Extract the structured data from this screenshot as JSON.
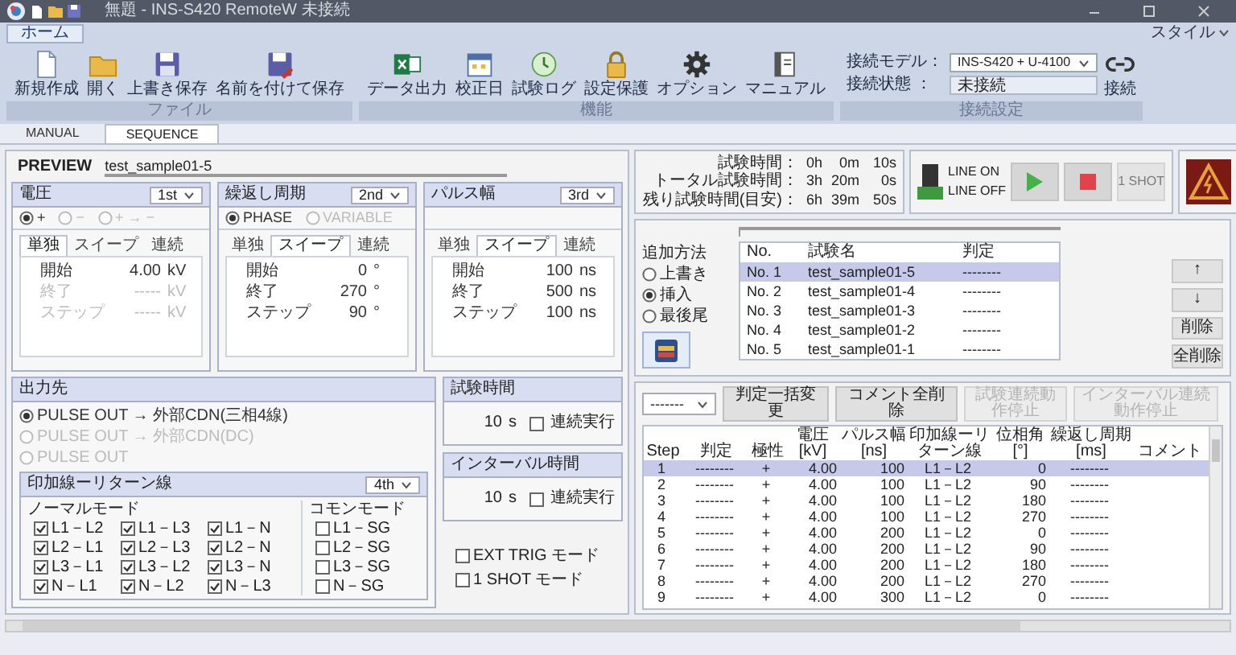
{
  "window": {
    "title": "無題 - INS-S420 RemoteW 未接続",
    "style_menu": "スタイル"
  },
  "ribbon": {
    "tabs": [
      {
        "label": "ホーム",
        "selected": true
      }
    ],
    "groups": [
      {
        "label": "ファイル",
        "buttons": [
          "新規作成",
          "開く",
          "上書き保存",
          "名前を付けて保存"
        ]
      },
      {
        "label": "機能",
        "buttons": [
          "データ出力",
          "校正日",
          "試験ログ",
          "設定保護",
          "オプション",
          "マニュアル"
        ]
      }
    ],
    "connection": {
      "label": "接続設定",
      "model_label": "接続モデル：",
      "model": "INS-S420 + U-4100",
      "status_label": "接続状態 ：",
      "status": "未接続",
      "connect_button": "接続"
    }
  },
  "mode_tabs": [
    {
      "label": "MANUAL",
      "selected": false
    },
    {
      "label": "SEQUENCE",
      "selected": true
    }
  ],
  "preview": {
    "label": "PREVIEW",
    "value": "test_sample01-5"
  },
  "panels": [
    {
      "title": "電圧",
      "order": "1st",
      "options": [
        {
          "label": "+",
          "selected": true,
          "disabled": false
        },
        {
          "label": "−",
          "selected": false,
          "disabled": true
        },
        {
          "label": "+ → −",
          "selected": false,
          "disabled": true
        }
      ],
      "tabs": [
        {
          "label": "単独",
          "selected": true
        },
        {
          "label": "スイープ",
          "selected": false
        },
        {
          "label": "連続",
          "selected": false
        }
      ],
      "fields": [
        {
          "label": "開始",
          "value": "4.00",
          "unit": "kV",
          "disabled": false
        },
        {
          "label": "終了",
          "value": "-----",
          "unit": "kV",
          "disabled": true
        },
        {
          "label": "ステップ",
          "value": "-----",
          "unit": "kV",
          "disabled": true
        }
      ]
    },
    {
      "title": "繰返し周期",
      "order": "2nd",
      "options": [
        {
          "label": "PHASE",
          "selected": true,
          "disabled": false
        },
        {
          "label": "VARIABLE",
          "selected": false,
          "disabled": true
        }
      ],
      "tabs": [
        {
          "label": "単独",
          "selected": false
        },
        {
          "label": "スイープ",
          "selected": true
        },
        {
          "label": "連続",
          "selected": false
        }
      ],
      "fields": [
        {
          "label": "開始",
          "value": "0",
          "unit": "°",
          "disabled": false
        },
        {
          "label": "終了",
          "value": "270",
          "unit": "°",
          "disabled": false
        },
        {
          "label": "ステップ",
          "value": "90",
          "unit": "°",
          "disabled": false
        }
      ]
    },
    {
      "title": "パルス幅",
      "order": "3rd",
      "tabs": [
        {
          "label": "単独",
          "selected": false
        },
        {
          "label": "スイープ",
          "selected": true
        },
        {
          "label": "連続",
          "selected": false
        }
      ],
      "fields": [
        {
          "label": "開始",
          "value": "100",
          "unit": "ns",
          "disabled": false
        },
        {
          "label": "終了",
          "value": "500",
          "unit": "ns",
          "disabled": false
        },
        {
          "label": "ステップ",
          "value": "100",
          "unit": "ns",
          "disabled": false
        }
      ]
    }
  ],
  "output": {
    "title": "出力先",
    "options": [
      {
        "label": "PULSE OUT → 外部CDN(三相4線)",
        "selected": true,
        "disabled": false
      },
      {
        "label": "PULSE OUT → 外部CDN(DC)",
        "selected": false,
        "disabled": true
      },
      {
        "label": "PULSE OUT",
        "selected": false,
        "disabled": true
      }
    ],
    "lines": {
      "title": "印加線ーリターン線",
      "order": "4th",
      "normal_label": "ノーマルモード",
      "common_label": "コモンモード",
      "normal": [
        {
          "label": "L1－L2",
          "checked": true
        },
        {
          "label": "L1－L3",
          "checked": true
        },
        {
          "label": "L1－N",
          "checked": true
        },
        {
          "label": "L2－L1",
          "checked": true
        },
        {
          "label": "L2－L3",
          "checked": true
        },
        {
          "label": "L2－N",
          "checked": true
        },
        {
          "label": "L3－L1",
          "checked": true
        },
        {
          "label": "L3－L2",
          "checked": true
        },
        {
          "label": "L3－N",
          "checked": true
        },
        {
          "label": "N－L1",
          "checked": true
        },
        {
          "label": "N－L2",
          "checked": true
        },
        {
          "label": "N－L3",
          "checked": true
        }
      ],
      "common": [
        {
          "label": "L1－SG",
          "checked": false
        },
        {
          "label": "L2－SG",
          "checked": false
        },
        {
          "label": "L3－SG",
          "checked": false
        },
        {
          "label": "N－SG",
          "checked": false
        }
      ]
    }
  },
  "test_time": {
    "title": "試験時間",
    "value": "10",
    "unit": "s",
    "repeat": {
      "label": "連続実行",
      "checked": false
    }
  },
  "interval": {
    "title": "インターバル時間",
    "value": "10",
    "unit": "s",
    "repeat": {
      "label": "連続実行",
      "checked": false
    }
  },
  "modes": [
    {
      "label": "EXT TRIG モード",
      "checked": false
    },
    {
      "label": "1 SHOT モード",
      "checked": false
    }
  ],
  "timers": [
    {
      "label": "試験時間：",
      "parts": [
        "0h",
        "0m",
        "10s"
      ]
    },
    {
      "label": "トータル試験時間：",
      "parts": [
        "3h",
        "20m",
        "0s"
      ]
    },
    {
      "label": "残り試験時間(目安)：",
      "parts": [
        "6h",
        "39m",
        "50s"
      ]
    }
  ],
  "line": {
    "on_label": "LINE ON",
    "off_label": "LINE OFF"
  },
  "controls": [
    {
      "kind": "play",
      "disabled": false
    },
    {
      "kind": "stop",
      "disabled": false
    },
    {
      "kind": "text",
      "label": "1 SHOT",
      "disabled": true
    }
  ],
  "sequence": {
    "add_method": {
      "label": "追加方法",
      "options": [
        {
          "label": "上書き",
          "selected": false
        },
        {
          "label": "挿入",
          "selected": true
        },
        {
          "label": "最後尾",
          "selected": false
        }
      ]
    },
    "columns": [
      "No.",
      "試験名",
      "判定"
    ],
    "rows": [
      {
        "no": "No.  1",
        "name": "test_sample01-5",
        "result": "--------",
        "selected": true
      },
      {
        "no": "No.  2",
        "name": "test_sample01-4",
        "result": "--------",
        "selected": false
      },
      {
        "no": "No.  3",
        "name": "test_sample01-3",
        "result": "--------",
        "selected": false
      },
      {
        "no": "No.  4",
        "name": "test_sample01-2",
        "result": "--------",
        "selected": false
      },
      {
        "no": "No.  5",
        "name": "test_sample01-1",
        "result": "--------",
        "selected": false
      }
    ],
    "buttons": [
      "↑",
      "↓",
      "削除",
      "全削除"
    ]
  },
  "steps": {
    "filter": "-------",
    "buttons": [
      {
        "label": "判定一括変更",
        "disabled": false
      },
      {
        "label": "コメント全削除",
        "disabled": false
      },
      {
        "label": "試験連続動作停止",
        "disabled": true
      },
      {
        "label": "インターバル連続動作停止",
        "disabled": true
      }
    ],
    "columns": [
      "Step",
      "判定",
      "極性",
      "電圧 [kV]",
      "パルス幅 [ns]",
      "印加線ーリターン線",
      "位相角 [°]",
      "繰返し周期 [ms]",
      "コメント"
    ],
    "rows": [
      {
        "cells": [
          "1",
          "--------",
          "+",
          "4.00",
          "100",
          "L1－L2",
          "0",
          "--------"
        ],
        "selected": true
      },
      {
        "cells": [
          "2",
          "--------",
          "+",
          "4.00",
          "100",
          "L1－L2",
          "90",
          "--------"
        ],
        "selected": false
      },
      {
        "cells": [
          "3",
          "--------",
          "+",
          "4.00",
          "100",
          "L1－L2",
          "180",
          "--------"
        ],
        "selected": false
      },
      {
        "cells": [
          "4",
          "--------",
          "+",
          "4.00",
          "100",
          "L1－L2",
          "270",
          "--------"
        ],
        "selected": false
      },
      {
        "cells": [
          "5",
          "--------",
          "+",
          "4.00",
          "200",
          "L1－L2",
          "0",
          "--------"
        ],
        "selected": false
      },
      {
        "cells": [
          "6",
          "--------",
          "+",
          "4.00",
          "200",
          "L1－L2",
          "90",
          "--------"
        ],
        "selected": false
      },
      {
        "cells": [
          "7",
          "--------",
          "+",
          "4.00",
          "200",
          "L1－L2",
          "180",
          "--------"
        ],
        "selected": false
      },
      {
        "cells": [
          "8",
          "--------",
          "+",
          "4.00",
          "200",
          "L1－L2",
          "270",
          "--------"
        ],
        "selected": false
      },
      {
        "cells": [
          "9",
          "--------",
          "+",
          "4.00",
          "300",
          "L1－L2",
          "0",
          "--------"
        ],
        "selected": false
      }
    ]
  }
}
